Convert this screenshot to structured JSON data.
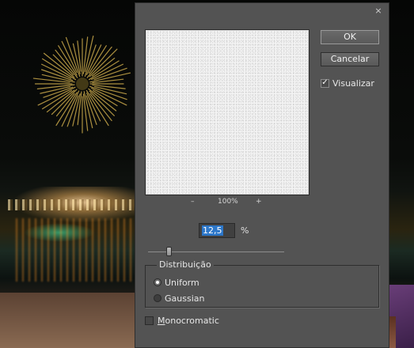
{
  "dialog": {
    "close_glyph": "×",
    "ok_label": "OK",
    "cancel_label": "Cancelar",
    "preview_label": "Visualizar",
    "preview_checked": true,
    "zoom": {
      "minus": "–",
      "level": "100%",
      "plus": "+"
    },
    "amount": {
      "value": "12,5",
      "unit": "%",
      "slider_value": 12.5
    },
    "distribution": {
      "legend": "Distribuição",
      "options": [
        {
          "label": "Uniform",
          "selected": true
        },
        {
          "label": "Gaussian",
          "selected": false
        }
      ]
    },
    "monochromatic": {
      "first_letter": "M",
      "rest": "onocromatic",
      "checked": false
    }
  },
  "icons": {
    "close": "close-icon",
    "check": "checkmark-icon"
  },
  "colors": {
    "dialog_bg": "#535353",
    "selection": "#2d77c9"
  }
}
